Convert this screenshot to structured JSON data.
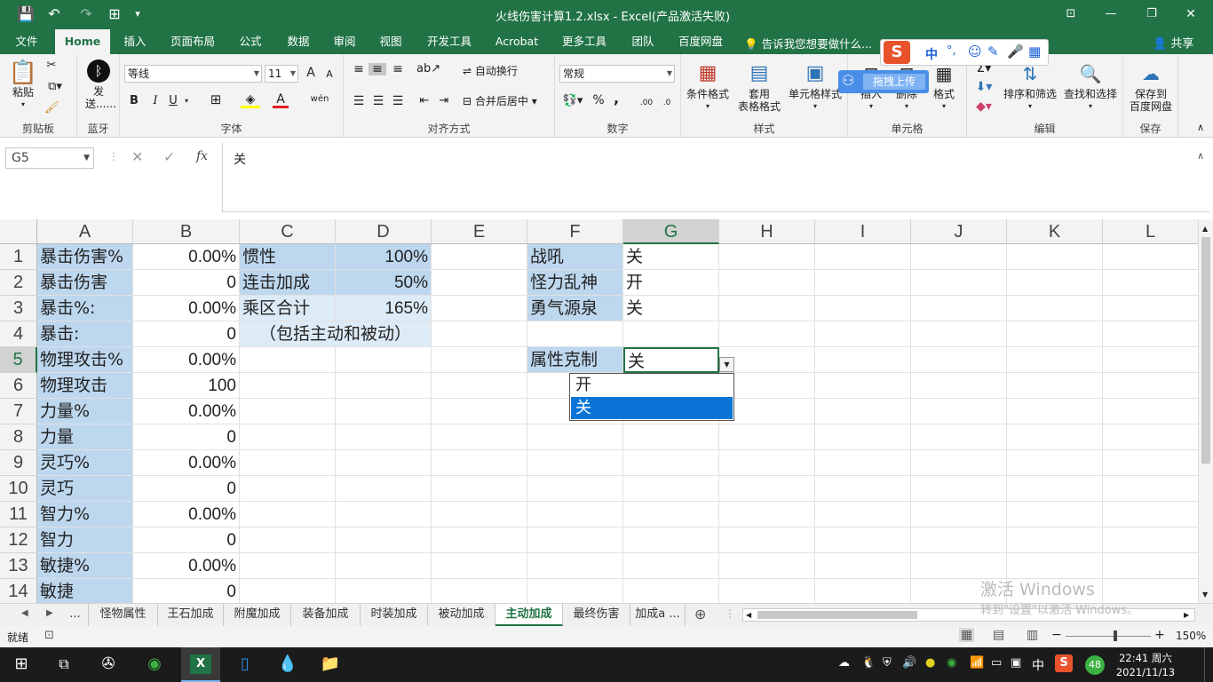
{
  "title": {
    "text": "火线伤害计算1.2.xlsx - Excel(产品激活失败)"
  },
  "qat": {
    "save": "💾",
    "undo": "↶",
    "redo": "↷",
    "form": "⊞",
    "more": "▾"
  },
  "window": {
    "restore_ribbon": "⊡",
    "minimize": "—",
    "maximize": "❐",
    "close": "✕"
  },
  "tabs": [
    "文件",
    "Home",
    "插入",
    "页面布局",
    "公式",
    "数据",
    "审阅",
    "视图",
    "开发工具",
    "Acrobat",
    "更多工具",
    "团队",
    "百度网盘"
  ],
  "tellme": "告诉我您想要做什么...",
  "share": "共享",
  "ime": {
    "logo": "S",
    "items": [
      "中",
      "°,",
      "☺",
      "✎",
      "🎤",
      "▦"
    ]
  },
  "upload_tip": "拖拽上传",
  "ribbon": {
    "clipboard": {
      "paste": "粘贴",
      "label": "剪贴板"
    },
    "bluetooth": {
      "send": "发送......",
      "label": "蓝牙"
    },
    "font": {
      "name": "等线",
      "size": "11",
      "label": "字体",
      "bold": "B",
      "italic": "I",
      "underline": "U",
      "grow": "A",
      "shrink": "A",
      "color_a": "A",
      "wen": "wén"
    },
    "align": {
      "wrap": "自动换行",
      "merge": "合并后居中",
      "label": "对齐方式"
    },
    "number": {
      "format": "常规",
      "percent": "%",
      "comma": ",",
      "inc": ".00",
      "dec": ".0",
      "label": "数字"
    },
    "styles": {
      "cond": "条件格式",
      "table1": "套用",
      "table2": "表格格式",
      "cell": "单元格样式",
      "label": "样式"
    },
    "cells": {
      "insert": "插入",
      "delete": "删除",
      "format": "格式",
      "label": "单元格"
    },
    "editing": {
      "sort": "排序和筛选",
      "find": "查找和选择",
      "label": "编辑"
    },
    "save": {
      "line1": "保存到",
      "line2": "百度网盘",
      "label": "保存"
    }
  },
  "formula": {
    "namebox": "G5",
    "cancel": "✕",
    "enter": "✓",
    "fx": "fx",
    "value": "关"
  },
  "columns": [
    "A",
    "B",
    "C",
    "D",
    "E",
    "F",
    "G",
    "H",
    "I",
    "J",
    "K",
    "L"
  ],
  "rows": [
    "1",
    "2",
    "3",
    "4",
    "5",
    "6",
    "7",
    "8",
    "9",
    "10",
    "11",
    "12",
    "13",
    "14"
  ],
  "cells": {
    "A1": "暴击伤害%",
    "B1": "0.00%",
    "C1": "惯性",
    "D1": "100%",
    "F1": "战吼",
    "G1": "关",
    "A2": "暴击伤害",
    "B2": "0",
    "C2": "连击加成",
    "D2": "50%",
    "F2": "怪力乱神",
    "G2": "开",
    "A3": "暴击%:",
    "B3": "0.00%",
    "C3": "乘区合计",
    "D3": "165%",
    "F3": "勇气源泉",
    "G3": "关",
    "A4": "暴击:",
    "B4": "0",
    "C4": "（包括主动和被动）",
    "A5": "物理攻击%",
    "B5": "0.00%",
    "F5": "属性克制",
    "G5": "关",
    "A6": "物理攻击",
    "B6": "100",
    "A7": "力量%",
    "B7": "0.00%",
    "A8": "力量",
    "B8": "0",
    "A9": "灵巧%",
    "B9": "0.00%",
    "A10": "灵巧",
    "B10": "0",
    "A11": "智力%",
    "B11": "0.00%",
    "A12": "智力",
    "B12": "0",
    "A13": "敏捷%",
    "B13": "0.00%",
    "A14": "敏捷",
    "B14": "0"
  },
  "dropdown": {
    "options": [
      "开",
      "关"
    ],
    "selected": "关"
  },
  "sheet_tabs": [
    "...",
    "怪物属性",
    "王石加成",
    "附魔加成",
    "装备加成",
    "时装加成",
    "被动加成",
    "主动加成",
    "最终伤害",
    "加成а ..."
  ],
  "active_sheet": "主动加成",
  "activation": {
    "line1": "激活 Windows",
    "line2": "转到\"设置\"以激活 Windows。"
  },
  "status": {
    "ready": "就绪",
    "zoom": "150%"
  },
  "taskbar": {
    "time": "22:41 周六",
    "date": "2021/11/13",
    "ime": "中",
    "badge": "48"
  }
}
